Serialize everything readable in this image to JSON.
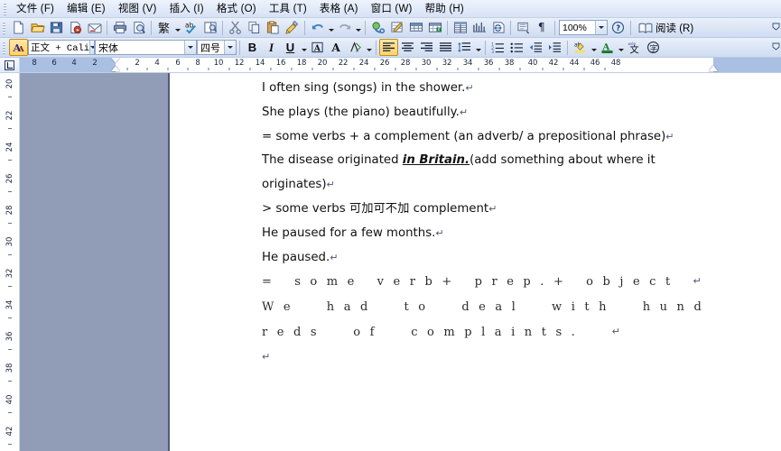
{
  "menu": {
    "items": [
      {
        "label": "文件 (F)",
        "name": "menu-file"
      },
      {
        "label": "编辑 (E)",
        "name": "menu-edit"
      },
      {
        "label": "视图 (V)",
        "name": "menu-view"
      },
      {
        "label": "插入 (I)",
        "name": "menu-insert"
      },
      {
        "label": "格式 (O)",
        "name": "menu-format"
      },
      {
        "label": "工具 (T)",
        "name": "menu-tools"
      },
      {
        "label": "表格 (A)",
        "name": "menu-table"
      },
      {
        "label": "窗口 (W)",
        "name": "menu-window"
      },
      {
        "label": "帮助 (H)",
        "name": "menu-help"
      }
    ]
  },
  "standard_toolbar": {
    "traditional_label": "繁",
    "zoom": {
      "value": "100%",
      "name": "zoom-combo"
    },
    "read_label": "阅读 (R)",
    "icons": [
      "new-document-icon",
      "open-folder-icon",
      "save-icon",
      "permission-icon",
      "email-icon",
      "print-icon",
      "print-preview-icon",
      "traditional-chinese-icon",
      "spelling-check-icon",
      "research-icon",
      "cut-icon",
      "copy-icon",
      "paste-icon",
      "format-painter-icon",
      "undo-icon",
      "redo-icon",
      "insert-hyperlink-icon",
      "tables-and-borders-icon",
      "insert-table-icon",
      "insert-excel-sheet-icon",
      "columns-icon",
      "drawing-icon",
      "document-map-icon",
      "show-hide-marks-icon",
      "help-icon",
      "reading-layout-icon"
    ]
  },
  "formatting_toolbar": {
    "style": "正文 + Cali",
    "font": "宋体",
    "size": "四号",
    "bold": "B",
    "italic": "I",
    "underline": "U",
    "icons": [
      "styles-and-formatting-icon",
      "character-border-icon",
      "grow-font-icon",
      "character-shading-icon",
      "align-left-icon",
      "align-center-icon",
      "align-right-icon",
      "justify-icon",
      "line-spacing-icon",
      "numbered-list-icon",
      "bulleted-list-icon",
      "decrease-indent-icon",
      "increase-indent-icon",
      "highlight-icon",
      "font-color-icon",
      "phonetic-guide-icon",
      "enclose-character-icon"
    ]
  },
  "ruler": {
    "horizontal_numbers": [
      8,
      6,
      4,
      2,
      2,
      4,
      6,
      8,
      10,
      12,
      14,
      16,
      18,
      20,
      22,
      24,
      26,
      28,
      30,
      32,
      34,
      36,
      38,
      40,
      42,
      44,
      46,
      48
    ],
    "vertical_numbers": [
      20,
      22,
      24,
      26,
      28,
      30,
      32,
      34,
      36,
      38,
      40,
      42
    ],
    "tab_selector": "left-tab-icon"
  },
  "document": {
    "paragraphs": [
      {
        "type": "plain",
        "text": "I often sing (songs) in the shower."
      },
      {
        "type": "plain",
        "text": "She plays (the piano) beautifully."
      },
      {
        "type": "plain",
        "text": "= some verbs + a complement (an adverb/ a prepositional phrase)"
      },
      {
        "type": "rich",
        "pre": "The   disease   originated  ",
        "emph": "in  Britain.",
        "post": "(add  something  about  where  it"
      },
      {
        "type": "plain",
        "text": "originates)"
      },
      {
        "type": "mixed",
        "pre": "> some verbs ",
        "cjk": "可加可不加",
        "post": " complement"
      },
      {
        "type": "plain",
        "text": "He paused for a few months."
      },
      {
        "type": "plain",
        "text": "He paused."
      },
      {
        "type": "justified",
        "parts": [
          "=",
          "s o m e",
          "v e r b +",
          "p r e p . +",
          "o b j e c t"
        ]
      },
      {
        "type": "justified",
        "parts": [
          "W e",
          "h a d",
          "t o",
          "d e a l",
          "w i t h",
          "h u n d"
        ]
      },
      {
        "type": "justified",
        "parts": [
          "r e d s",
          "o f",
          "c o m p l a i n t s .",
          ""
        ]
      },
      {
        "type": "empty",
        "text": ""
      }
    ],
    "pilcrow": "↵"
  },
  "colors": {
    "toolbar_top": "#eaf0fb",
    "toolbar_bottom": "#cfdcf1",
    "gray_pane": "#919db7",
    "page": "#ffffff",
    "ruler_margin": "#a9c0e2",
    "accent": "#2b4a7d"
  }
}
